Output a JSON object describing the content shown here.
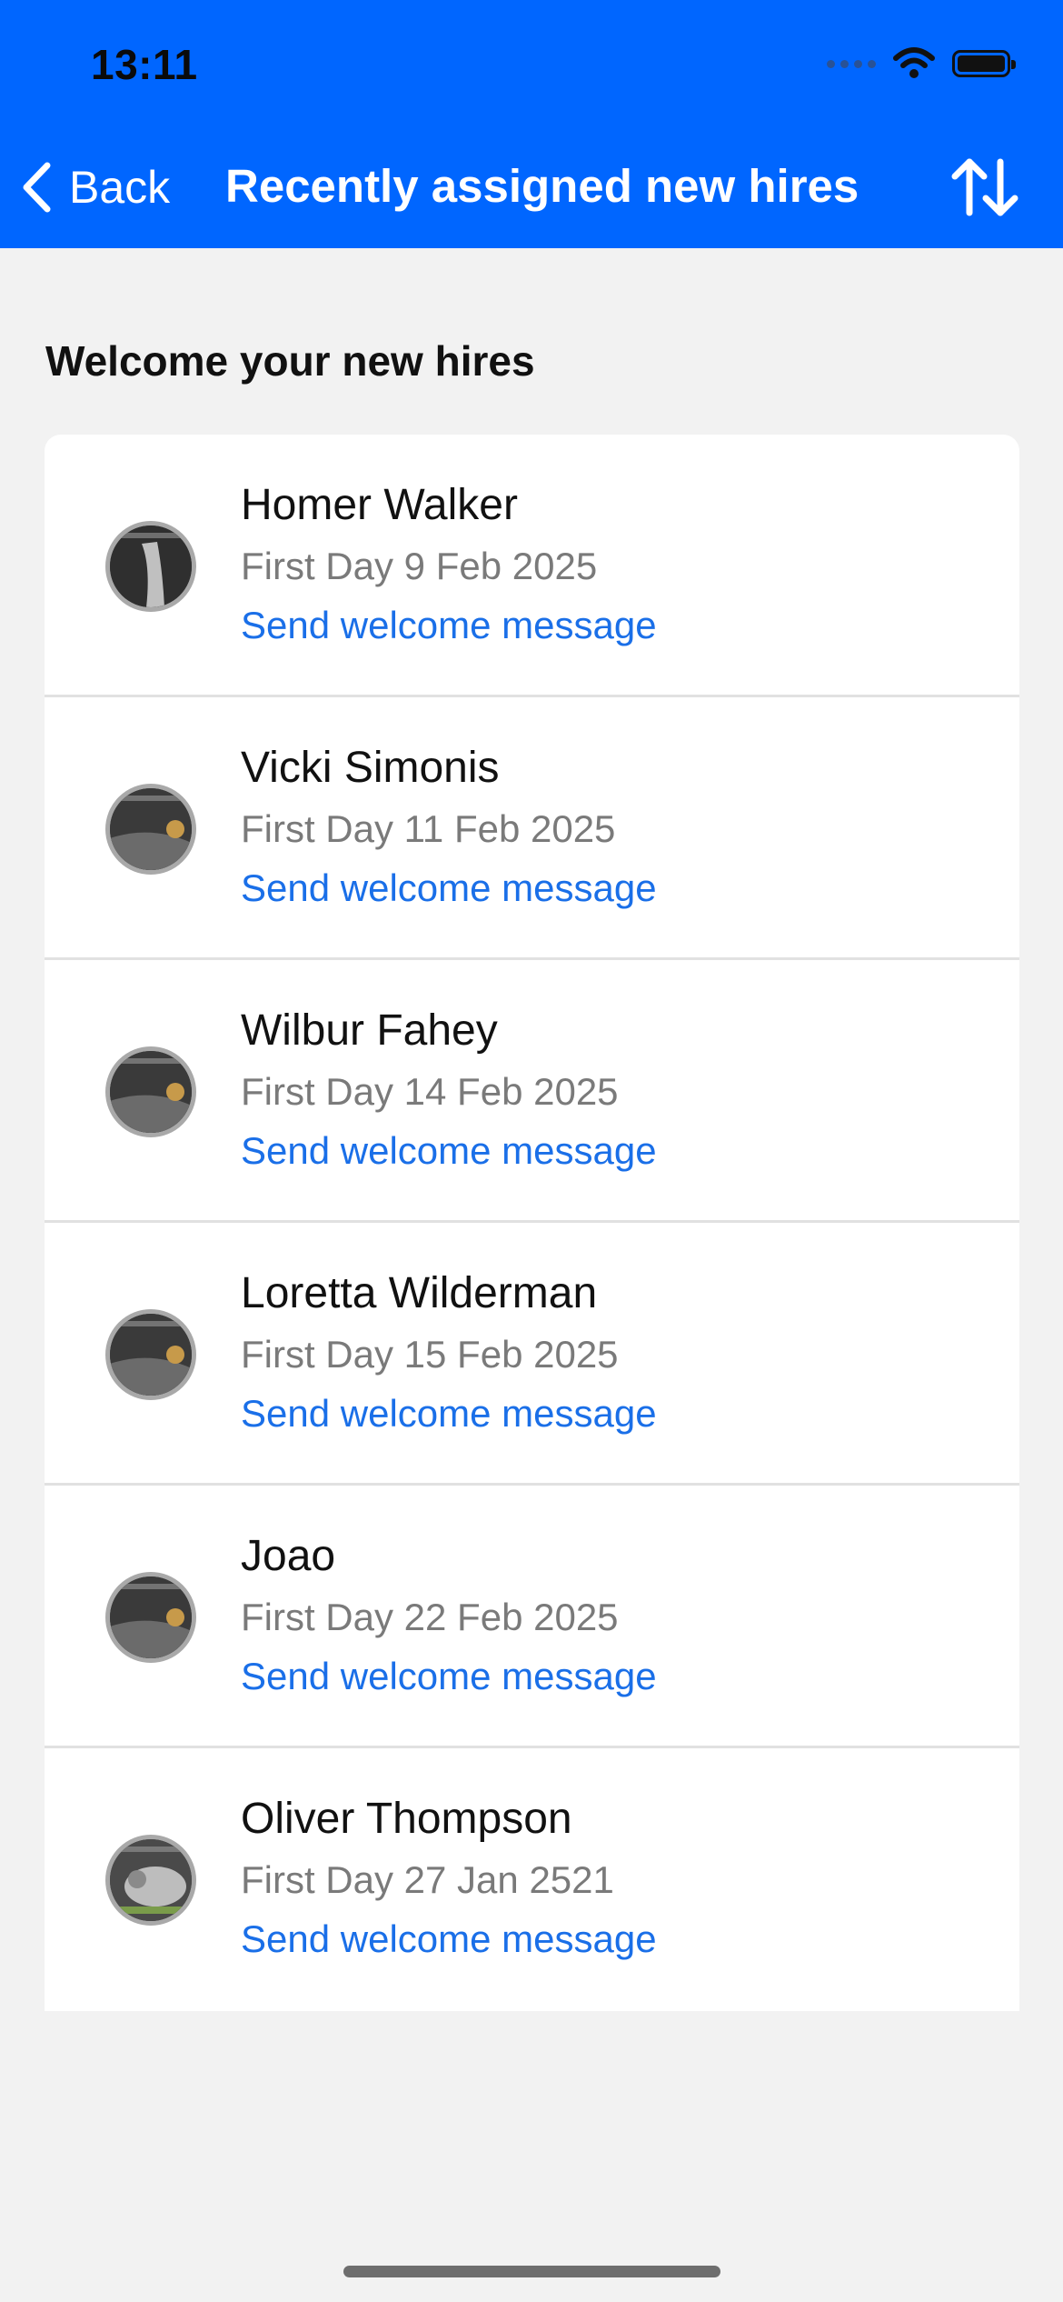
{
  "status_bar": {
    "time": "13:11"
  },
  "nav": {
    "back_label": "Back",
    "title": "Recently assigned new hires",
    "sort_icon": "sort-arrows-icon"
  },
  "section": {
    "title": "Welcome your new hires"
  },
  "hires": [
    {
      "name": "Homer Walker",
      "first_day": "First Day 9 Feb 2025",
      "action": "Send welcome message"
    },
    {
      "name": "Vicki Simonis",
      "first_day": "First Day 11 Feb 2025",
      "action": "Send welcome message"
    },
    {
      "name": "Wilbur Fahey",
      "first_day": "First Day 14 Feb 2025",
      "action": "Send welcome message"
    },
    {
      "name": "Loretta Wilderman",
      "first_day": "First Day 15 Feb 2025",
      "action": "Send welcome message"
    },
    {
      "name": "Joao",
      "first_day": "First Day 22 Feb 2025",
      "action": "Send welcome message"
    },
    {
      "name": "Oliver Thompson",
      "first_day": "First Day 27 Jan 2521",
      "action": "Send welcome message"
    }
  ],
  "colors": {
    "header": "#0066ff",
    "link": "#1a6fe8",
    "background": "#f2f2f2"
  }
}
